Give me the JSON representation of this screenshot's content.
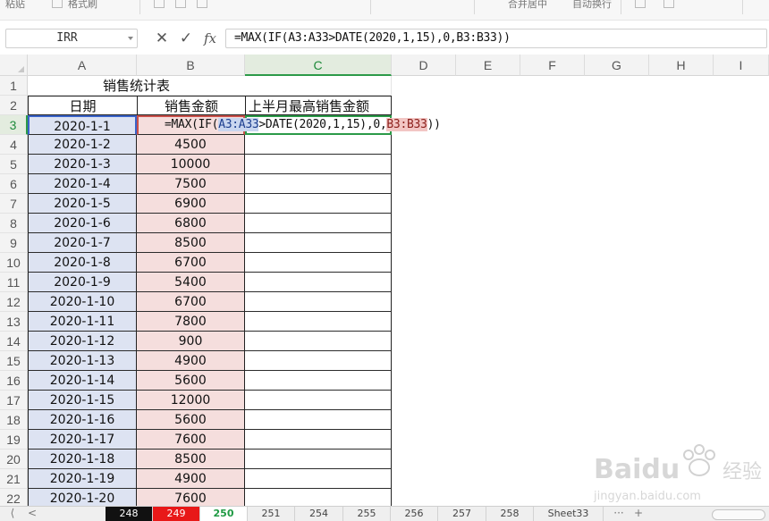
{
  "toolbar": {
    "item_1": "粘贴",
    "item_2": "格式刷",
    "item_3": "合并居中",
    "item_4": "自动换行"
  },
  "formula_bar": {
    "name_box": "IRR",
    "cancel_glyph": "✕",
    "confirm_glyph": "✓",
    "fx_label": "fx",
    "formula": "=MAX(IF(A3:A33>DATE(2020,1,15),0,B3:B33))"
  },
  "columns": [
    "A",
    "B",
    "C",
    "D",
    "E",
    "F",
    "G",
    "H",
    "I"
  ],
  "rows": [
    "1",
    "2",
    "3",
    "4",
    "5",
    "6",
    "7",
    "8",
    "9",
    "10",
    "11",
    "12",
    "13",
    "14",
    "15",
    "16",
    "17",
    "18",
    "19",
    "20",
    "21",
    "22"
  ],
  "sheet": {
    "title": "销售统计表",
    "headers": {
      "date": "日期",
      "sales": "销售金额",
      "max": "上半月最高销售金额"
    },
    "editing": {
      "prefix": "=MAX(IF(",
      "ref_a": "A3:A33",
      "mid": ">DATE(2020,1,15),0,",
      "ref_b": "B3:B33",
      "suffix": "))"
    },
    "data": [
      {
        "date": "2020-1-1",
        "sales": ""
      },
      {
        "date": "2020-1-2",
        "sales": "4500"
      },
      {
        "date": "2020-1-3",
        "sales": "10000"
      },
      {
        "date": "2020-1-4",
        "sales": "7500"
      },
      {
        "date": "2020-1-5",
        "sales": "6900"
      },
      {
        "date": "2020-1-6",
        "sales": "6800"
      },
      {
        "date": "2020-1-7",
        "sales": "8500"
      },
      {
        "date": "2020-1-8",
        "sales": "6700"
      },
      {
        "date": "2020-1-9",
        "sales": "5400"
      },
      {
        "date": "2020-1-10",
        "sales": "6700"
      },
      {
        "date": "2020-1-11",
        "sales": "7800"
      },
      {
        "date": "2020-1-12",
        "sales": "900"
      },
      {
        "date": "2020-1-13",
        "sales": "4900"
      },
      {
        "date": "2020-1-14",
        "sales": "5600"
      },
      {
        "date": "2020-1-15",
        "sales": "12000"
      },
      {
        "date": "2020-1-16",
        "sales": "5600"
      },
      {
        "date": "2020-1-17",
        "sales": "7600"
      },
      {
        "date": "2020-1-18",
        "sales": "8500"
      },
      {
        "date": "2020-1-19",
        "sales": "4900"
      },
      {
        "date": "2020-1-20",
        "sales": "7600"
      }
    ]
  },
  "tabs": [
    {
      "label": "248",
      "style": "black"
    },
    {
      "label": "249",
      "style": "red"
    },
    {
      "label": "250",
      "style": "active"
    },
    {
      "label": "251",
      "style": ""
    },
    {
      "label": "254",
      "style": ""
    },
    {
      "label": "255",
      "style": ""
    },
    {
      "label": "256",
      "style": ""
    },
    {
      "label": "257",
      "style": ""
    },
    {
      "label": "258",
      "style": ""
    },
    {
      "label": "Sheet33",
      "style": ""
    }
  ],
  "tab_nav": {
    "prev": "<",
    "more": "···",
    "add": "+"
  },
  "watermark": {
    "brand": "Baidu",
    "tag": "经验",
    "url": "jingyan.baidu.com"
  },
  "colors": {
    "date_fill": "#dde3f2",
    "sales_fill": "#f5dedd",
    "active_green": "#2b9a48"
  }
}
